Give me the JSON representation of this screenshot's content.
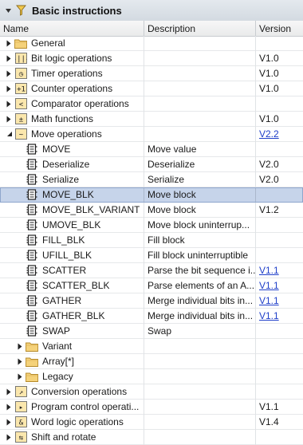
{
  "window": {
    "title": "Basic instructions"
  },
  "columns": {
    "name": "Name",
    "description": "Description",
    "version": "Version"
  },
  "rows": [
    {
      "level": 0,
      "expand": "collapsed",
      "icon": "folder-icon",
      "name": "General",
      "desc": "",
      "ver": ""
    },
    {
      "level": 0,
      "expand": "collapsed",
      "icon": "bit-logic-icon",
      "name": "Bit logic operations",
      "desc": "",
      "ver": "V1.0"
    },
    {
      "level": 0,
      "expand": "collapsed",
      "icon": "timer-icon",
      "name": "Timer operations",
      "desc": "",
      "ver": "V1.0"
    },
    {
      "level": 0,
      "expand": "collapsed",
      "icon": "counter-icon",
      "name": "Counter operations",
      "desc": "",
      "ver": "V1.0"
    },
    {
      "level": 0,
      "expand": "collapsed",
      "icon": "comparator-icon",
      "name": "Comparator operations",
      "desc": "",
      "ver": ""
    },
    {
      "level": 0,
      "expand": "collapsed",
      "icon": "math-icon",
      "name": "Math functions",
      "desc": "",
      "ver": "V1.0"
    },
    {
      "level": 0,
      "expand": "expanded",
      "icon": "move-icon",
      "name": "Move operations",
      "desc": "",
      "ver": "V2.2",
      "link": true
    },
    {
      "level": 1,
      "expand": "none",
      "icon": "instruction-block-icon",
      "name": "MOVE",
      "desc": "Move value",
      "ver": ""
    },
    {
      "level": 1,
      "expand": "none",
      "icon": "instruction-block-icon",
      "name": "Deserialize",
      "desc": "Deserialize",
      "ver": "V2.0"
    },
    {
      "level": 1,
      "expand": "none",
      "icon": "instruction-block-icon",
      "name": "Serialize",
      "desc": "Serialize",
      "ver": "V2.0"
    },
    {
      "level": 1,
      "expand": "none",
      "icon": "instruction-block-icon",
      "name": "MOVE_BLK",
      "desc": "Move block",
      "ver": "",
      "selected": true
    },
    {
      "level": 1,
      "expand": "none",
      "icon": "instruction-block-icon",
      "name": "MOVE_BLK_VARIANT",
      "desc": "Move block",
      "ver": "V1.2"
    },
    {
      "level": 1,
      "expand": "none",
      "icon": "instruction-block-icon",
      "name": "UMOVE_BLK",
      "desc": "Move block uninterrup...",
      "ver": ""
    },
    {
      "level": 1,
      "expand": "none",
      "icon": "instruction-block-icon",
      "name": "FILL_BLK",
      "desc": "Fill block",
      "ver": ""
    },
    {
      "level": 1,
      "expand": "none",
      "icon": "instruction-block-icon",
      "name": "UFILL_BLK",
      "desc": "Fill block uninterruptible",
      "ver": ""
    },
    {
      "level": 1,
      "expand": "none",
      "icon": "instruction-block-icon",
      "name": "SCATTER",
      "desc": "Parse the bit sequence i...",
      "ver": "V1.1",
      "link": true
    },
    {
      "level": 1,
      "expand": "none",
      "icon": "instruction-block-icon",
      "name": "SCATTER_BLK",
      "desc": "Parse elements of an A...",
      "ver": "V1.1",
      "link": true
    },
    {
      "level": 1,
      "expand": "none",
      "icon": "instruction-block-icon",
      "name": "GATHER",
      "desc": "Merge individual bits in...",
      "ver": "V1.1",
      "link": true
    },
    {
      "level": 1,
      "expand": "none",
      "icon": "instruction-block-icon",
      "name": "GATHER_BLK",
      "desc": "Merge individual bits in...",
      "ver": "V1.1",
      "link": true
    },
    {
      "level": 1,
      "expand": "none",
      "icon": "instruction-block-icon",
      "name": "SWAP",
      "desc": "Swap",
      "ver": ""
    },
    {
      "level": 1,
      "expand": "collapsed",
      "icon": "folder-icon",
      "name": "Variant",
      "desc": "",
      "ver": ""
    },
    {
      "level": 1,
      "expand": "collapsed",
      "icon": "folder-icon",
      "name": "Array[*]",
      "desc": "",
      "ver": ""
    },
    {
      "level": 1,
      "expand": "collapsed",
      "icon": "folder-icon",
      "name": "Legacy",
      "desc": "",
      "ver": ""
    },
    {
      "level": 0,
      "expand": "collapsed",
      "icon": "conversion-icon",
      "name": "Conversion operations",
      "desc": "",
      "ver": ""
    },
    {
      "level": 0,
      "expand": "collapsed",
      "icon": "program-control-icon",
      "name": "Program control operati...",
      "desc": "",
      "ver": "V1.1"
    },
    {
      "level": 0,
      "expand": "collapsed",
      "icon": "word-logic-icon",
      "name": "Word logic operations",
      "desc": "",
      "ver": "V1.4"
    },
    {
      "level": 0,
      "expand": "collapsed",
      "icon": "shift-rotate-icon",
      "name": "Shift and rotate",
      "desc": "",
      "ver": ""
    }
  ]
}
